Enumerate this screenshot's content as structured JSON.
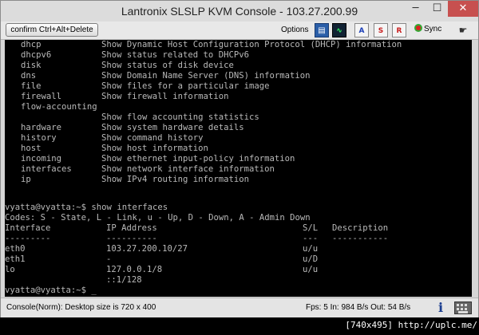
{
  "window": {
    "title": "Lantronix SLSLP KVM Console - 103.27.200.99",
    "minimize_glyph": "─",
    "maximize_glyph": "☐",
    "close_glyph": "✕"
  },
  "toolbar": {
    "ctrl_alt_del_label": "confirm Ctrl+Alt+Delete",
    "options_label": "Options",
    "a_label": "A",
    "s_label": "S",
    "r_label": "R",
    "sync_label": "Sync"
  },
  "terminal": {
    "help_rows": [
      {
        "cmd": "dhcp",
        "desc": "Show Dynamic Host Configuration Protocol (DHCP) information"
      },
      {
        "cmd": "dhcpv6",
        "desc": "Show status related to DHCPv6"
      },
      {
        "cmd": "disk",
        "desc": "Show status of disk device"
      },
      {
        "cmd": "dns",
        "desc": "Show Domain Name Server (DNS) information"
      },
      {
        "cmd": "file",
        "desc": "Show files for a particular image"
      },
      {
        "cmd": "firewall",
        "desc": "Show firewall information"
      },
      {
        "cmd": "flow-accounting",
        "desc": ""
      },
      {
        "cmd": "",
        "desc": "Show flow accounting statistics"
      },
      {
        "cmd": "hardware",
        "desc": "Show system hardware details"
      },
      {
        "cmd": "history",
        "desc": "Show command history"
      },
      {
        "cmd": "host",
        "desc": "Show host information"
      },
      {
        "cmd": "incoming",
        "desc": "Show ethernet input-policy information"
      },
      {
        "cmd": "interfaces",
        "desc": "Show network interface information"
      },
      {
        "cmd": "ip",
        "desc": "Show IPv4 routing information"
      }
    ],
    "prompt_command": "vyatta@vyatta:~$ show interfaces",
    "codes_line": "Codes: S - State, L - Link, u - Up, D - Down, A - Admin Down",
    "table_headers": [
      "Interface",
      "IP Address",
      "S/L",
      "Description"
    ],
    "table_dashes": [
      "---------",
      "----------",
      "---",
      "-----------"
    ],
    "table_rows": [
      [
        "eth0",
        "103.27.200.10/27",
        "u/u",
        ""
      ],
      [
        "eth1",
        "-",
        "u/D",
        ""
      ],
      [
        "lo",
        "127.0.0.1/8",
        "u/u",
        ""
      ],
      [
        "",
        "::1/128",
        "",
        ""
      ]
    ],
    "final_prompt": "vyatta@vyatta:~$ _"
  },
  "status": {
    "left_text": "Console(Norm): Desktop size is 720 x 400",
    "right_text": "Fps: 5 In: 984 B/s Out: 54 B/s"
  },
  "footer": {
    "credit": "[740x495] http://uplc.me/"
  },
  "colors": {
    "terminal_bg": "#000000",
    "terminal_fg": "#b9b9b9",
    "close_button": "#c7504f"
  }
}
